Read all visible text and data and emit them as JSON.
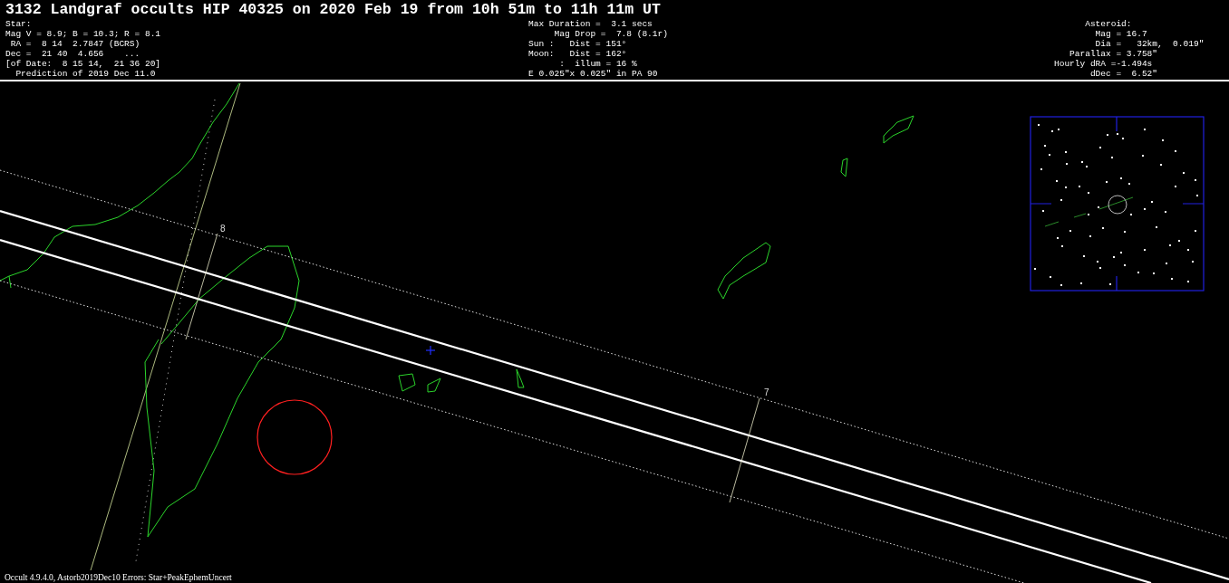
{
  "title": "3132 Landgraf occults HIP 40325 on 2020 Feb 19 from 10h 51m to 11h 11m UT",
  "star_info": [
    "Star:",
    "Mag V = 8.9; B = 10.3; R = 8.1",
    " RA =  8 14  2.7847 (BCRS)",
    "Dec =  21 40  4.656    ...",
    "[of Date:  8 15 14,  21 36 20]",
    "  Prediction of 2019 Dec 11.0"
  ],
  "event_info": [
    "Max Duration =  3.1 secs",
    "     Mag Drop =  7.8 (8.1r)",
    "Sun :   Dist = 151°",
    "Moon:   Dist = 162°",
    "      :  illum = 16 %",
    "E 0.025\"x 0.025\" in PA 90"
  ],
  "asteroid_info": [
    "      Asteroid:",
    "        Mag = 16.7",
    "        Dia =   32km,  0.019\"",
    "   Parallax = 3.758\"",
    "Hourly dRA =-1.494s",
    "       dDec =  6.52\""
  ],
  "time_marks": [
    {
      "label": "8"
    },
    {
      "label": "7"
    }
  ],
  "footer": "Occult 4.9.4.0, Astorb2019Dec10  Errors: Star+PeakEphemUncert"
}
